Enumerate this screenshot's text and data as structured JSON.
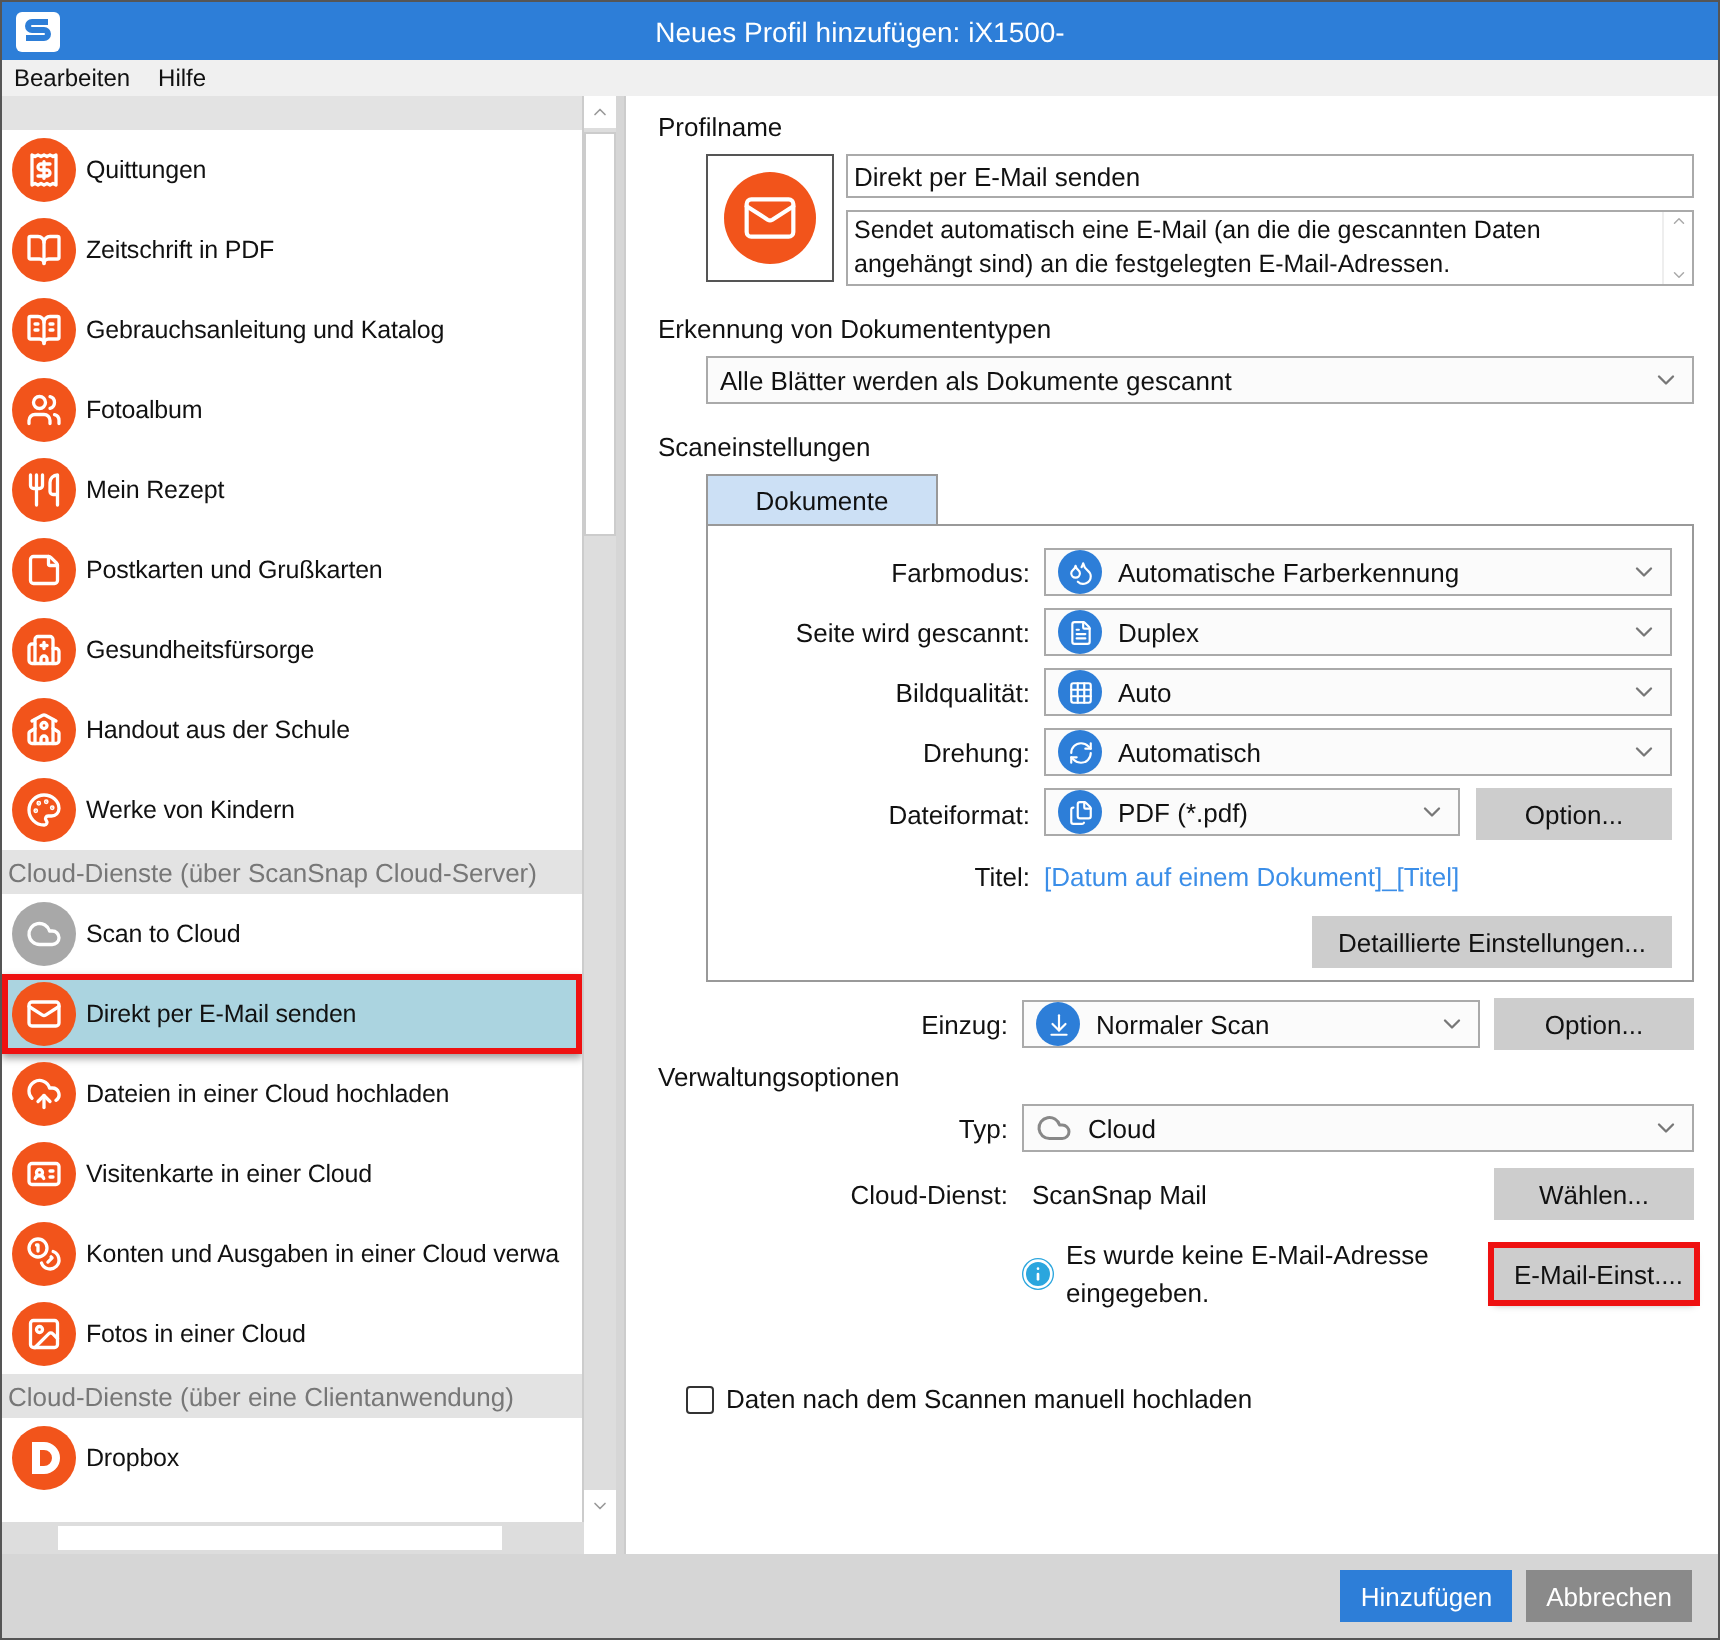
{
  "window": {
    "title": "Neues Profil hinzufügen: iX1500-"
  },
  "menu": [
    "Bearbeiten",
    "Hilfe"
  ],
  "sidebar": {
    "sections": [
      {
        "items": [
          {
            "label": "Quittungen",
            "selected": false,
            "annotated": false
          },
          {
            "label": "Zeitschrift in PDF",
            "selected": false,
            "annotated": false
          },
          {
            "label": "Gebrauchsanleitung und Katalog",
            "selected": false,
            "annotated": false
          },
          {
            "label": "Fotoalbum",
            "selected": false,
            "annotated": false
          },
          {
            "label": "Mein Rezept",
            "selected": false,
            "annotated": false
          },
          {
            "label": "Postkarten und Grußkarten",
            "selected": false,
            "annotated": false
          },
          {
            "label": "Gesundheitsfürsorge",
            "selected": false,
            "annotated": false
          },
          {
            "label": "Handout aus der Schule",
            "selected": false,
            "annotated": false
          },
          {
            "label": "Werke von Kindern",
            "selected": false,
            "annotated": false
          }
        ]
      },
      {
        "title": "Cloud-Dienste (über ScanSnap Cloud-Server)",
        "items": [
          {
            "label": "Scan to Cloud",
            "selected": false,
            "annotated": false
          },
          {
            "label": "Direkt per E-Mail senden",
            "selected": true,
            "annotated": true
          },
          {
            "label": "Dateien in einer Cloud hochladen",
            "selected": false,
            "annotated": false
          },
          {
            "label": "Visitenkarte in einer Cloud",
            "selected": false,
            "annotated": false
          },
          {
            "label": "Konten und Ausgaben in einer Cloud verwa",
            "selected": false,
            "annotated": false
          },
          {
            "label": "Fotos in einer Cloud",
            "selected": false,
            "annotated": false
          }
        ]
      },
      {
        "title": "Cloud-Dienste (über eine Clientanwendung)",
        "items": [
          {
            "label": "Dropbox",
            "selected": false,
            "annotated": false
          }
        ]
      }
    ]
  },
  "profile": {
    "label": "Profilname",
    "name": "Direkt per E-Mail senden",
    "description": "Sendet automatisch eine E-Mail (an die die gescannten Daten angehängt sind) an die festgelegten E-Mail-Adressen."
  },
  "doc_type": {
    "label": "Erkennung von Dokumententypen",
    "value": "Alle Blätter werden als Dokumente gescannt"
  },
  "scan_settings": {
    "label": "Scaneinstellungen",
    "tabs": [
      {
        "label": "Dokumente",
        "selected": true
      }
    ],
    "rows": [
      {
        "kind": "select",
        "label": "Farbmodus:",
        "value": "Automatische Farberkennung"
      },
      {
        "kind": "select",
        "label": "Seite wird gescannt:",
        "value": "Duplex"
      },
      {
        "kind": "select",
        "label": "Bildqualität:",
        "value": "Auto"
      },
      {
        "kind": "select",
        "label": "Drehung:",
        "value": "Automatisch"
      },
      {
        "kind": "select_button",
        "label": "Dateiformat:",
        "value": "PDF (*.pdf)",
        "button": "Option..."
      },
      {
        "kind": "link",
        "label": "Titel:",
        "value": "[Datum auf einem Dokument]_[Titel]"
      }
    ],
    "detail_button": "Detaillierte Einstellungen..."
  },
  "feed": {
    "label": "Einzug:",
    "value": "Normaler Scan",
    "button": "Option..."
  },
  "management": {
    "label": "Verwaltungsoptionen",
    "type": {
      "label": "Typ:",
      "value": "Cloud"
    },
    "cloud_service": {
      "label": "Cloud-Dienst:",
      "value": "ScanSnap Mail",
      "button": "Wählen..."
    },
    "info": {
      "text": "Es wurde keine E-Mail-Adresse eingegeben.",
      "button": "E-Mail-Einst....",
      "annotated": true
    }
  },
  "upload_checkbox": {
    "label": "Daten nach dem Scannen manuell hochladen",
    "checked": false
  },
  "footer": [
    {
      "label": "Hinzufügen",
      "kind": "primary"
    },
    {
      "label": "Abbrechen",
      "kind": "secondary"
    }
  ]
}
